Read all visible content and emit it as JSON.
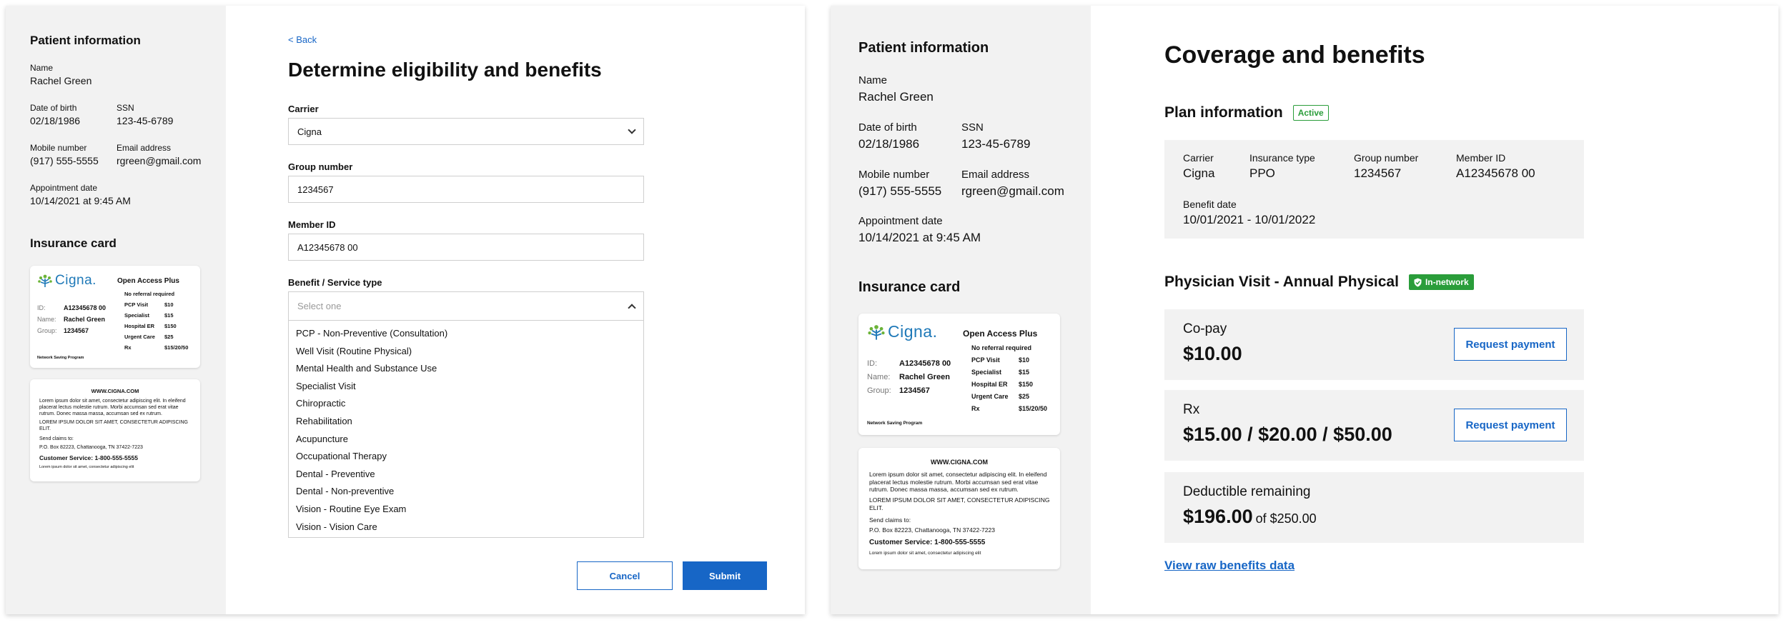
{
  "patient": {
    "section_title": "Patient information",
    "name_label": "Name",
    "name": "Rachel Green",
    "dob_label": "Date of birth",
    "dob": "02/18/1986",
    "ssn_label": "SSN",
    "ssn": "123-45-6789",
    "mobile_label": "Mobile number",
    "mobile": "(917) 555-5555",
    "email_label": "Email address",
    "email": "rgreen@gmail.com",
    "appt_label": "Appointment date",
    "appt": "10/14/2021 at 9:45 AM"
  },
  "insurance_card": {
    "section_title": "Insurance card",
    "logo_text": "Cigna.",
    "plan_name": "Open Access Plus",
    "no_referral": "No referral required",
    "benefits": [
      {
        "label": "PCP Visit",
        "value": "$10"
      },
      {
        "label": "Specialist",
        "value": "$15"
      },
      {
        "label": "Hospital ER",
        "value": "$150"
      },
      {
        "label": "Urgent Care",
        "value": "$25"
      },
      {
        "label": "Rx",
        "value": "$15/20/50"
      }
    ],
    "id_label": "ID:",
    "id_value": "A12345678 00",
    "name_label": "Name:",
    "name_value": "Rachel Green",
    "group_label": "Group:",
    "group_value": "1234567",
    "network_text": "Network Saving Program",
    "back_url": "WWW.CIGNA.COM",
    "back_lorem": "Lorem ipsum dolor sit amet, consectetur adipiscing elit. In eleifend placerat lectus molestie rutrum. Morbi accumsan sed erat vitae rutrum. Donec massa massa, accumsan sed ex rutrum.",
    "back_caps": "LOREM IPSUM DOLOR SIT AMET, CONSECTETUR ADIPISCING ELIT.",
    "send_claims": "Send claims to:",
    "address": "P.O. Box 82223, Chattanooga, TN 37422-7223",
    "customer_service": "Customer Service: 1-800-555-5555",
    "fine_print": "Lorem ipsum dolor sit amet, consectetur adipiscing elit"
  },
  "form": {
    "back_link": "< Back",
    "title": "Determine eligibility and benefits",
    "carrier_label": "Carrier",
    "carrier_value": "Cigna",
    "group_label": "Group number",
    "group_value": "1234567",
    "member_label": "Member ID",
    "member_value": "A12345678 00",
    "benefit_label": "Benefit / Service type",
    "benefit_placeholder": "Select one",
    "benefit_options": [
      "PCP - Non-Preventive (Consultation)",
      "Well Visit (Routine Physical)",
      "Mental Health and Substance Use",
      "Specialist Visit",
      "Chiropractic",
      "Rehabilitation",
      "Acupuncture",
      "Occupational Therapy",
      "Dental - Preventive",
      "Dental - Non-preventive",
      "Vision - Routine Eye Exam",
      "Vision - Vision Care"
    ],
    "cancel_label": "Cancel",
    "submit_label": "Submit"
  },
  "coverage": {
    "title": "Coverage and benefits",
    "plan_section_title": "Plan information",
    "plan_status": "Active",
    "carrier_label": "Carrier",
    "carrier": "Cigna",
    "type_label": "Insurance type",
    "type": "PPO",
    "group_label": "Group number",
    "group": "1234567",
    "member_label": "Member ID",
    "member": "A12345678 00",
    "benefit_date_label": "Benefit date",
    "benefit_date": "10/01/2021 - 10/01/2022",
    "visit_title": "Physician Visit - Annual Physical",
    "network_badge": "In-network",
    "copay_label": "Co-pay",
    "copay_value": "$10.00",
    "rx_label": "Rx",
    "rx_value": "$15.00 / $20.00 / $50.00",
    "request_payment_label": "Request payment",
    "deductible_label": "Deductible remaining",
    "deductible_value": "$196.00",
    "deductible_of": "of $250.00",
    "raw_link": "View raw benefits data"
  },
  "colors": {
    "accent": "#1766c6",
    "success": "#2a9d3a",
    "sidebar_bg": "#f2f2f2",
    "cigna_blue": "#1f79b8",
    "cigna_green": "#6bb338"
  }
}
